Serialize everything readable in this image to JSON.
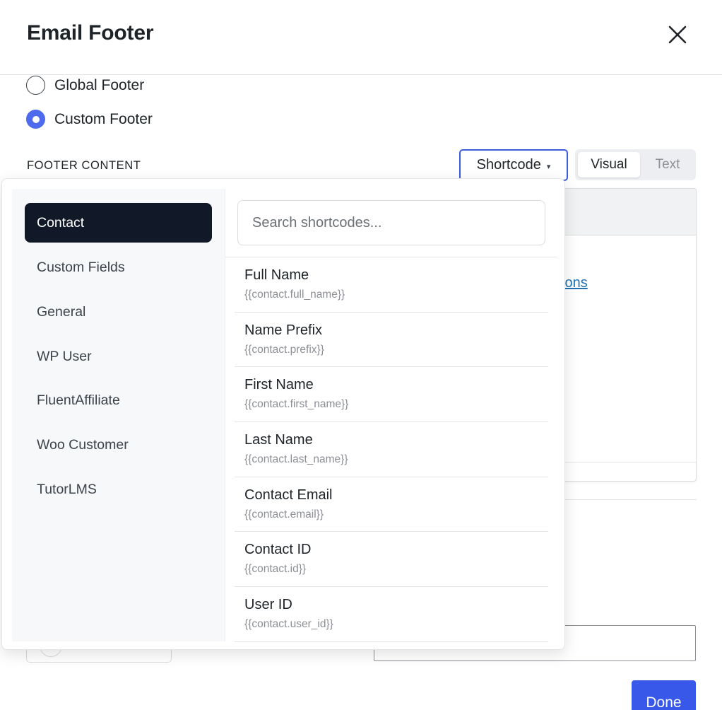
{
  "modal": {
    "title": "Email Footer",
    "close_icon": "close-icon"
  },
  "footer_type": {
    "options": [
      {
        "label": "Global Footer",
        "checked": false
      },
      {
        "label": "Custom Footer",
        "checked": true
      }
    ]
  },
  "footer_content": {
    "label": "FOOTER CONTENT",
    "shortcode_label": "Shortcode",
    "shortcode_caret": "▾",
    "modes": {
      "visual": "Visual",
      "text": "Text"
    },
    "active_mode": "Visual",
    "editor_link_fragment": "ions"
  },
  "dropdown": {
    "categories": [
      {
        "label": "Contact",
        "active": true
      },
      {
        "label": "Custom Fields",
        "active": false
      },
      {
        "label": "General",
        "active": false
      },
      {
        "label": "WP User",
        "active": false
      },
      {
        "label": "FluentAffiliate",
        "active": false
      },
      {
        "label": "Woo Customer",
        "active": false
      },
      {
        "label": "TutorLMS",
        "active": false
      }
    ],
    "search_placeholder": "Search shortcodes...",
    "search_value": "",
    "items": [
      {
        "name": "Full Name",
        "code": "{{contact.full_name}}"
      },
      {
        "name": "Name Prefix",
        "code": "{{contact.prefix}}"
      },
      {
        "name": "First Name",
        "code": "{{contact.first_name}}"
      },
      {
        "name": "Last Name",
        "code": "{{contact.last_name}}"
      },
      {
        "name": "Contact Email",
        "code": "{{contact.email}}"
      },
      {
        "name": "Contact ID",
        "code": "{{contact.id}}"
      },
      {
        "name": "User ID",
        "code": "{{contact.user_id}}"
      }
    ]
  },
  "actions": {
    "done_label": "Done"
  },
  "colors": {
    "accent": "#4f6bed",
    "primary_button": "#3858e9",
    "active_category_bg": "#111827",
    "link": "#2271b1"
  }
}
